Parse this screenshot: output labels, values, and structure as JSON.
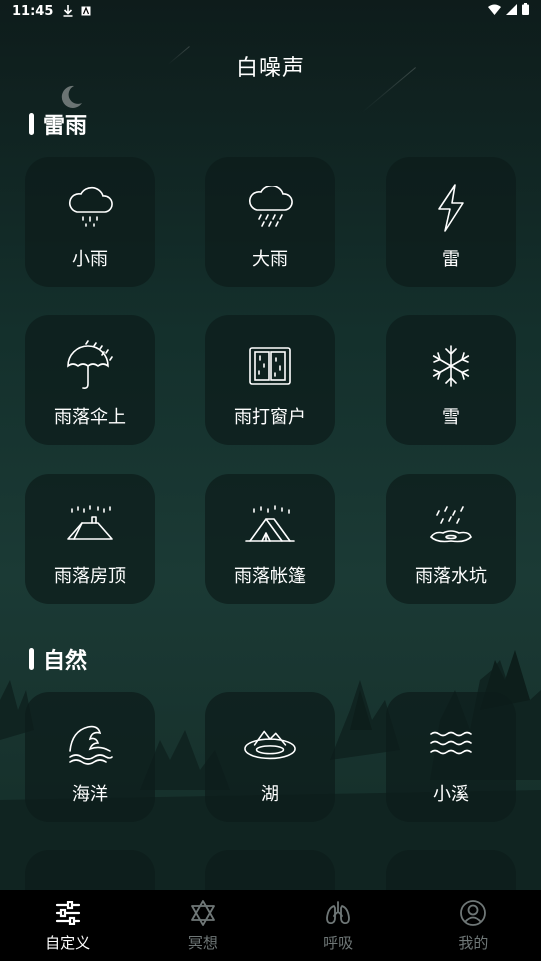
{
  "status_bar": {
    "time": "11:45"
  },
  "page": {
    "title": "白噪声"
  },
  "sections": [
    {
      "title": "雷雨",
      "items": [
        {
          "label": "小雨",
          "icon": "light-rain-icon"
        },
        {
          "label": "大雨",
          "icon": "heavy-rain-icon"
        },
        {
          "label": "雷",
          "icon": "lightning-icon"
        },
        {
          "label": "雨落伞上",
          "icon": "umbrella-rain-icon"
        },
        {
          "label": "雨打窗户",
          "icon": "window-icon"
        },
        {
          "label": "雪",
          "icon": "snowflake-icon"
        },
        {
          "label": "雨落房顶",
          "icon": "roof-rain-icon"
        },
        {
          "label": "雨落帐篷",
          "icon": "tent-rain-icon"
        },
        {
          "label": "雨落水坑",
          "icon": "puddle-rain-icon"
        }
      ]
    },
    {
      "title": "自然",
      "items": [
        {
          "label": "海洋",
          "icon": "wave-icon"
        },
        {
          "label": "湖",
          "icon": "lake-icon"
        },
        {
          "label": "小溪",
          "icon": "stream-icon"
        }
      ]
    }
  ],
  "tabs": [
    {
      "label": "自定义",
      "icon": "sliders-icon",
      "active": true
    },
    {
      "label": "冥想",
      "icon": "star-of-david-icon",
      "active": false
    },
    {
      "label": "呼吸",
      "icon": "lungs-icon",
      "active": false
    },
    {
      "label": "我的",
      "icon": "user-icon",
      "active": false
    }
  ],
  "colors": {
    "accent_active": "#ffffff",
    "inactive": "#6f7777",
    "tile_bg": "#0c1c1a"
  }
}
